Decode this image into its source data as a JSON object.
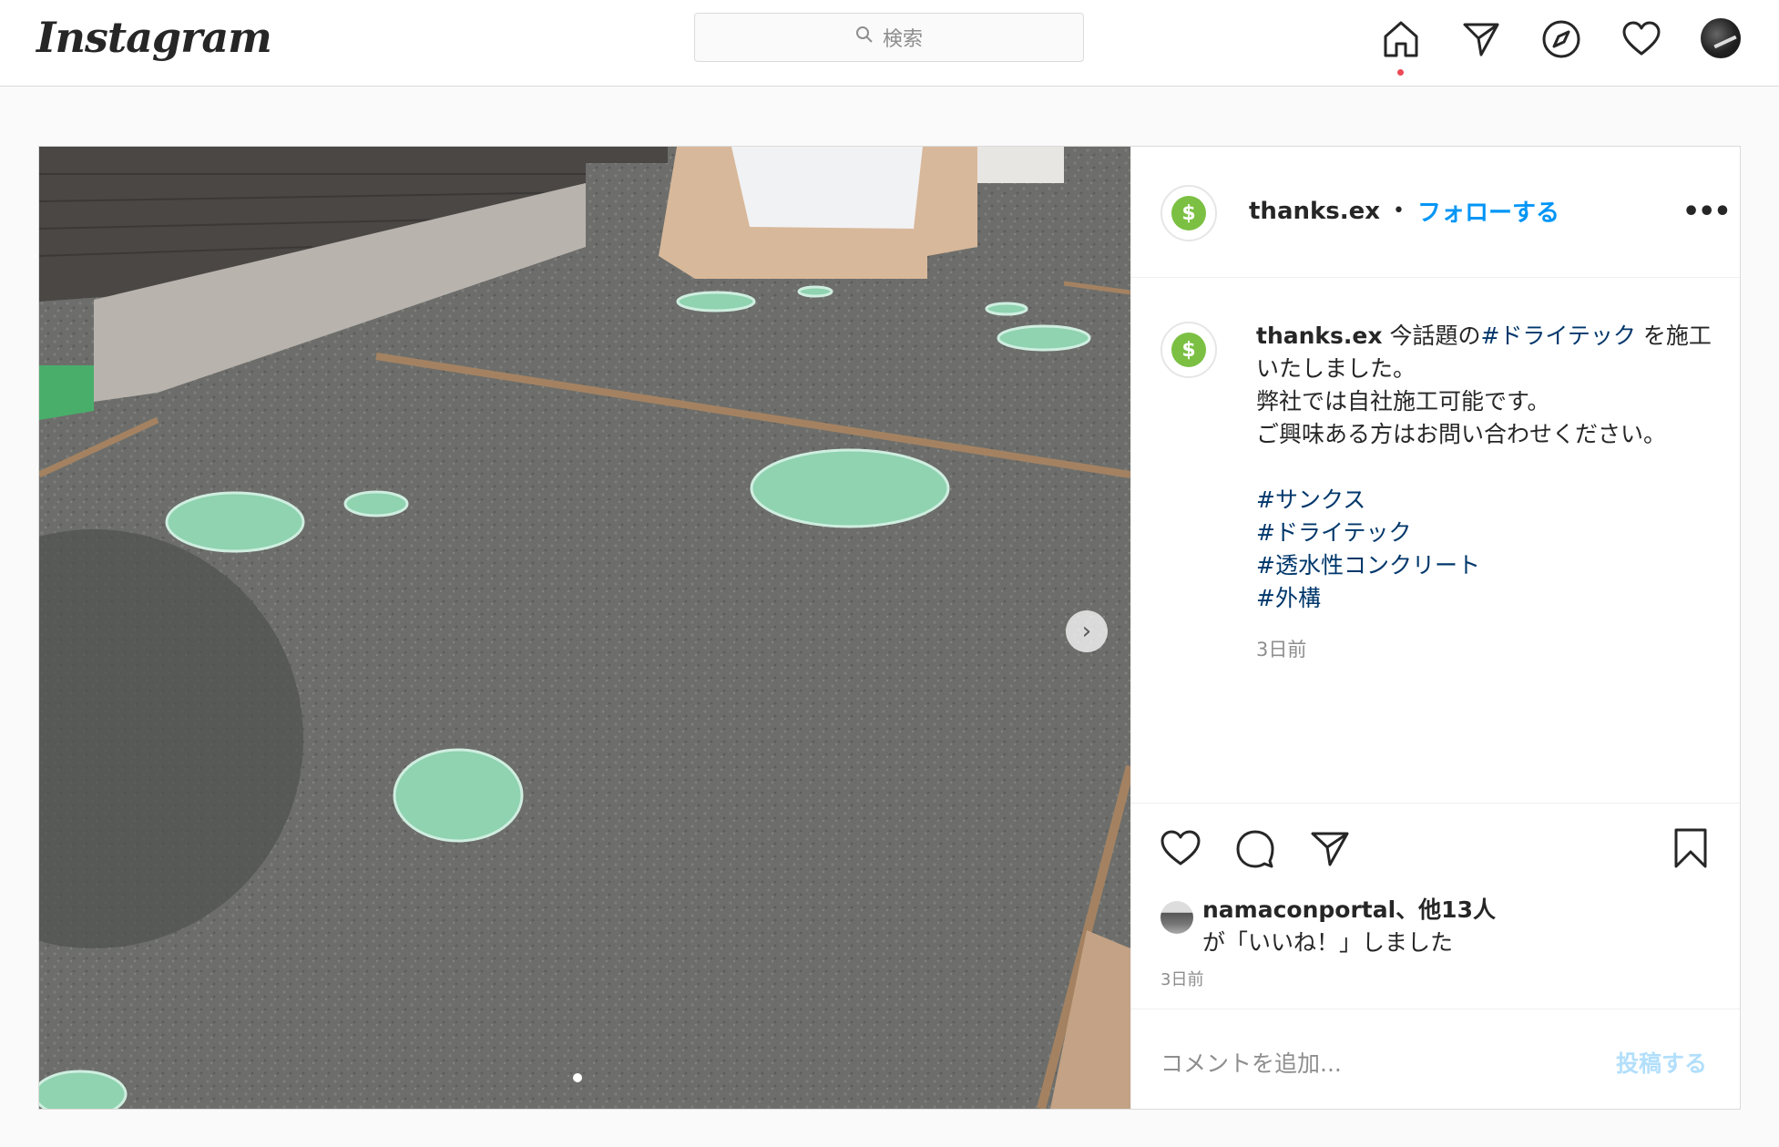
{
  "app": {
    "logo_text": "Instagram",
    "search_placeholder": "検索"
  },
  "nav": {
    "icons": [
      "home-icon",
      "direct-message-icon",
      "explore-icon",
      "activity-heart-icon",
      "profile-avatar"
    ]
  },
  "post": {
    "author": "thanks.ex",
    "separator": "•",
    "follow_label": "フォローする",
    "more_label": "•••",
    "caption": {
      "author": "thanks.ex",
      "text_before_tag": " 今話題の",
      "inline_tag": "#ドライテック",
      "text_after_tag": " を施工いたしました。",
      "line2": "弊社では自社施工可能です。",
      "line3": "ご興味ある方はお問い合わせください。",
      "hashtags": [
        "#サンクス",
        "#ドライテック",
        "#透水性コンクリート",
        "#外構"
      ],
      "time": "3日前"
    },
    "likes": {
      "liker": "namaconportal",
      "others": "、他13人",
      "suffix": "が「いいね！」しました"
    },
    "post_time": "3日前",
    "comment_placeholder": "コメントを追加...",
    "post_button_label": "投稿する",
    "next_arrow": "›"
  }
}
